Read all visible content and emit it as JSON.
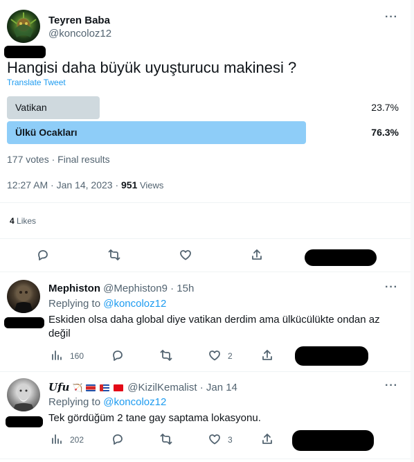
{
  "tweet": {
    "display_name": "Teyren Baba",
    "handle": "@koncoloz12",
    "text": "Hangisi daha büyük uyuşturucu makinesi ?",
    "translate": "Translate Tweet",
    "poll": {
      "options": [
        {
          "label": "Vatikan",
          "percent": "23.7%",
          "fraction": 0.237,
          "winner": false
        },
        {
          "label": "Ülkü Ocakları",
          "percent": "76.3%",
          "fraction": 0.763,
          "winner": true
        }
      ],
      "summary": "177 votes · Final results"
    },
    "timestamp": "12:27 AM · Jan 14, 2023 · ",
    "views_count": "951",
    "views_label": " Views",
    "likes_count": "4",
    "likes_label": " Likes",
    "colors": {
      "winner_bar": "#8ecdf8",
      "loser_bar": "#cfd9de",
      "link": "#1d9bf0"
    }
  },
  "replies": [
    {
      "display_name": "Mephiston",
      "handle": "@Mephiston9",
      "time": "· 15h",
      "replying_prefix": "Replying to ",
      "replying_to": "@koncoloz12",
      "text": "Eskiden olsa daha global diye vatikan derdim ama ülkücülükte ondan az değil",
      "views": "160",
      "likes": "2"
    },
    {
      "display_name": "Ufu",
      "handle": "@KizilKemalist",
      "time": "· Jan 14",
      "replying_prefix": "Replying to ",
      "replying_to": "@koncoloz12",
      "text": "Tek gördüğüm 2 tane gay saptama lokasyonu.",
      "views": "202",
      "likes": "3"
    }
  ],
  "icons": [
    "more-icon",
    "reply-icon",
    "retweet-icon",
    "like-icon",
    "share-icon",
    "views-icon"
  ]
}
